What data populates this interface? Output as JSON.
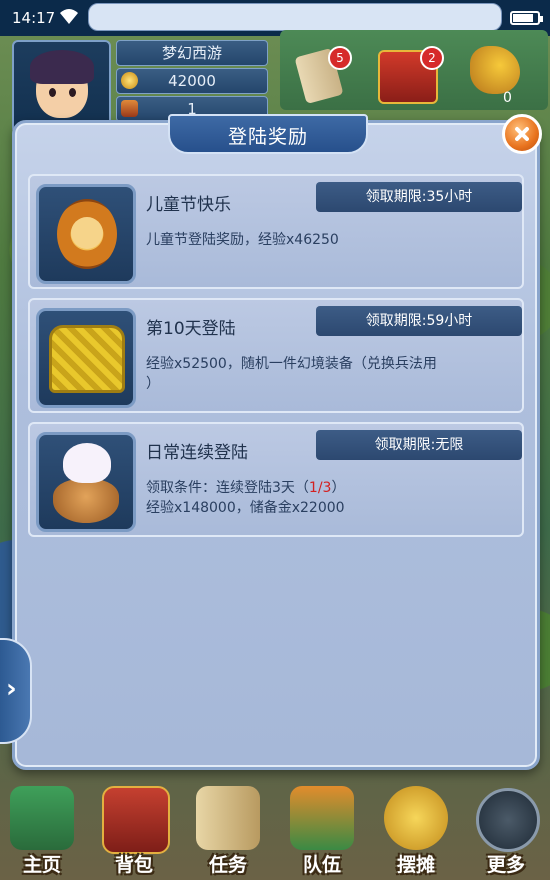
{
  "status_bar": {
    "time": "14:17",
    "battery_level": 0.85
  },
  "player": {
    "name": "梦幻西游",
    "gold": "42000",
    "bag_count": "1"
  },
  "top_icons": {
    "scroll_badge": "5",
    "chest_badge": "2",
    "axe_count": "0"
  },
  "dialog": {
    "title": "登陆奖励",
    "items": [
      {
        "name": "儿童节快乐",
        "deadline": "领取期限:35小时",
        "desc_line1": "儿童节登陆奖励，经验x46250"
      },
      {
        "name": "第10天登陆",
        "deadline": "领取期限:59小时",
        "desc_line1": "经验x52500，随机一件幻境装备（兑换兵法用",
        "desc_line2": "）"
      },
      {
        "name": "日常连续登陆",
        "deadline": "领取期限:无限",
        "cond_prefix": "领取条件：连续登陆3天（",
        "cond_progress": "1/3",
        "cond_suffix": "）",
        "desc_line2": "经验x148000，储备金x22000"
      }
    ]
  },
  "side_arrow": "›",
  "bottom_nav": [
    "主页",
    "背包",
    "任务",
    "队伍",
    "摆摊",
    "更多"
  ],
  "colors": {
    "progress_red": "#d32020",
    "close_orange": "#e8731e"
  }
}
